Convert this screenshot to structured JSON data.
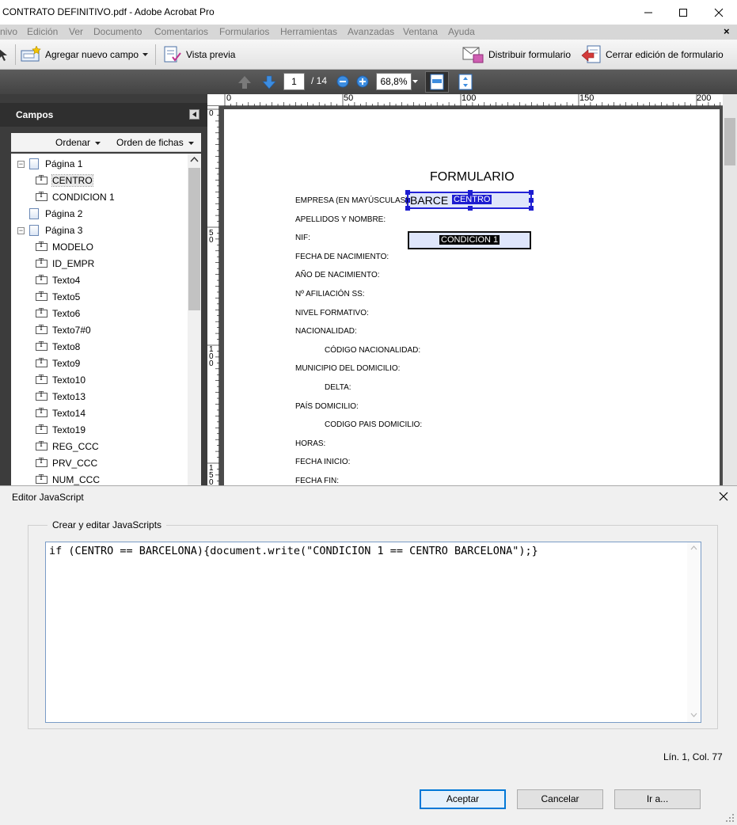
{
  "window": {
    "title": "CONTRATO DEFINITIVO.pdf - Adobe Acrobat Pro"
  },
  "menu": [
    "nivo",
    "Edición",
    "Ver",
    "Documento",
    "Comentarios",
    "Formularios",
    "Herramientas",
    "Avanzadas",
    "Ventana",
    "Ayuda"
  ],
  "menu_close": "×",
  "toolbar": {
    "add_field": "Agregar nuevo campo",
    "preview": "Vista previa",
    "distribute": "Distribuir formulario",
    "close_edit": "Cerrar edición de formulario"
  },
  "nav": {
    "page_current": "1",
    "page_total": "/ 14",
    "zoom": "68,8%"
  },
  "panel": {
    "title": "Campos",
    "sort": "Ordenar",
    "tab_order": "Orden de fichas",
    "tree": [
      {
        "label": "Página 1",
        "type": "page",
        "expander": "−"
      },
      {
        "label": "CENTRO",
        "type": "field",
        "selected": true
      },
      {
        "label": "CONDICION 1",
        "type": "field"
      },
      {
        "label": "Página 2",
        "type": "page",
        "expander": ""
      },
      {
        "label": "Página 3",
        "type": "page",
        "expander": "−"
      },
      {
        "label": "MODELO",
        "type": "field"
      },
      {
        "label": "ID_EMPR",
        "type": "field"
      },
      {
        "label": "Texto4",
        "type": "field"
      },
      {
        "label": "Texto5",
        "type": "field"
      },
      {
        "label": "Texto6",
        "type": "field"
      },
      {
        "label": "Texto7#0",
        "type": "field"
      },
      {
        "label": "Texto8",
        "type": "field"
      },
      {
        "label": "Texto9",
        "type": "field"
      },
      {
        "label": "Texto10",
        "type": "field"
      },
      {
        "label": "Texto13",
        "type": "field"
      },
      {
        "label": "Texto14",
        "type": "field"
      },
      {
        "label": "Texto19",
        "type": "field"
      },
      {
        "label": "REG_CCC",
        "type": "field"
      },
      {
        "label": "PRV_CCC",
        "type": "field"
      },
      {
        "label": "NUM_CCC",
        "type": "field"
      }
    ]
  },
  "ruler": {
    "h": [
      "0",
      "50",
      "100",
      "150",
      "200"
    ],
    "v": [
      [
        "0"
      ],
      [
        "5",
        "0"
      ],
      [
        "1",
        "0",
        "0"
      ],
      [
        "1",
        "5",
        "0"
      ]
    ]
  },
  "document": {
    "heading": "FORMULARIO",
    "centro_value": "BARCE",
    "centro_tag": "CENTRO",
    "condicion_tag": "CONDICION 1",
    "labels": [
      {
        "text": "EMPRESA (EN MAYÚSCULAS):",
        "indent": false
      },
      {
        "text": "APELLIDOS Y NOMBRE:",
        "indent": false
      },
      {
        "text": "NIF:",
        "indent": false
      },
      {
        "text": "FECHA DE NACIMIENTO:",
        "indent": false
      },
      {
        "text": "AÑO DE NACIMIENTO:",
        "indent": false
      },
      {
        "text": "Nº AFILIACIÓN SS:",
        "indent": false
      },
      {
        "text": "NIVEL FORMATIVO:",
        "indent": false
      },
      {
        "text": "NACIONALIDAD:",
        "indent": false
      },
      {
        "text": "CÓDIGO NACIONALIDAD:",
        "indent": true
      },
      {
        "text": "MUNICIPIO DEL DOMICILIO:",
        "indent": false
      },
      {
        "text": "DELTA:",
        "indent": true
      },
      {
        "text": "PAÍS DOMICILIO:",
        "indent": false
      },
      {
        "text": "CODIGO PAIS DOMICILIO:",
        "indent": true
      },
      {
        "text": "HORAS:",
        "indent": false
      },
      {
        "text": "FECHA INICIO:",
        "indent": false
      },
      {
        "text": "FECHA FIN:",
        "indent": false
      }
    ]
  },
  "dialog": {
    "title": "Editor JavaScript",
    "group_label": "Crear y editar JavaScripts",
    "code": "if (CENTRO == BARCELONA){document.write(\"CONDICION 1 == CENTRO BARCELONA\");}",
    "cursor": "Lín. 1, Col. 77",
    "accept": "Aceptar",
    "cancel": "Cancelar",
    "goto": "Ir a..."
  }
}
